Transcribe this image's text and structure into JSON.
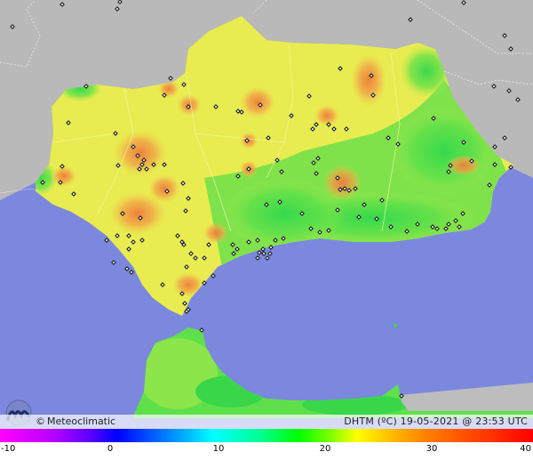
{
  "map": {
    "brand": "Meteoclimatic",
    "copyright_symbol": "©",
    "variable": "DHTM (ºC)",
    "timestamp": "19-05-2021 @ 23:53 UTC",
    "legend": {
      "min": -10,
      "max": 40,
      "tick_labels": [
        "-10",
        "0",
        "10",
        "20",
        "30",
        "40"
      ]
    },
    "colors": {
      "sea": "#7b88de",
      "land_outside": "#b8b8b8",
      "land_mild": "#e6ee4e",
      "land_cool": "#86e84a",
      "land_cold": "#42dd4e",
      "land_warm": "#f0b84a",
      "land_hot": "#ef8a3e"
    },
    "icons": [
      "meteoclimatic-logo-icon",
      "station-marker-icon"
    ]
  }
}
